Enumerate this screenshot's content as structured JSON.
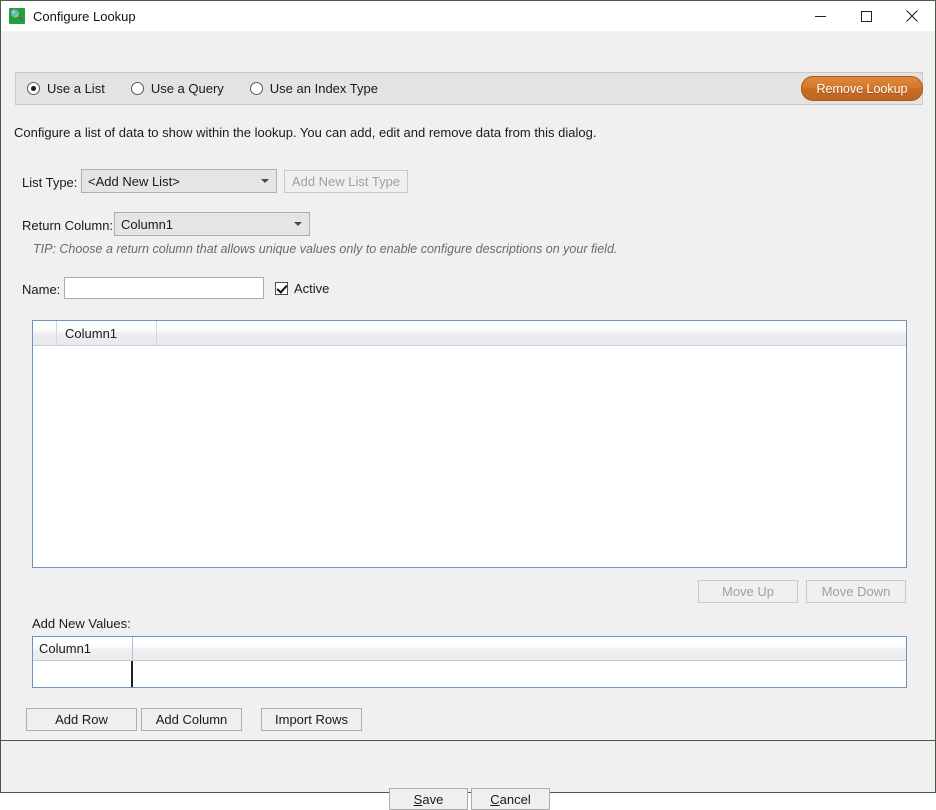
{
  "window": {
    "title": "Configure Lookup",
    "icon": "lookup-app-icon",
    "controls": {
      "minimize": "minimize-icon",
      "maximize": "maximize-icon",
      "close": "close-icon"
    }
  },
  "mode_options": [
    {
      "label": "Use a List",
      "selected": true
    },
    {
      "label": "Use a Query",
      "selected": false
    },
    {
      "label": "Use an Index Type",
      "selected": false
    }
  ],
  "remove_lookup": {
    "label": "Remove Lookup",
    "color": "#d3762a"
  },
  "description": "Configure a list of data to show within the lookup. You can add, edit and remove data from this dialog.",
  "list_type": {
    "label": "List Type:",
    "value": "<Add New List>",
    "options": [
      "<Add New List>"
    ],
    "add_button": "Add New List Type",
    "add_button_disabled": true
  },
  "return_column": {
    "label": "Return Column:",
    "value": "Column1",
    "options": [
      "Column1"
    ]
  },
  "tip": "TIP: Choose a return column that allows unique values only to enable configure descriptions on your field.",
  "name_field": {
    "label": "Name:",
    "value": "",
    "placeholder": ""
  },
  "active_checkbox": {
    "label": "Active",
    "checked": true
  },
  "main_grid": {
    "columns": [
      "",
      "Column1",
      ""
    ],
    "rows": []
  },
  "move_buttons": {
    "up": "Move Up",
    "down": "Move Down",
    "disabled": true
  },
  "add_new_values": {
    "label": "Add New Values:",
    "columns": [
      "Column1",
      ""
    ],
    "rows": [
      [
        "",
        ""
      ]
    ]
  },
  "row_buttons": {
    "add_row": "Add Row",
    "add_column": "Add Column",
    "import_rows": "Import Rows"
  },
  "footer": {
    "save": {
      "prefix": "",
      "accel": "S",
      "suffix": "ave"
    },
    "cancel": {
      "prefix": "",
      "accel": "C",
      "suffix": "ancel"
    }
  }
}
